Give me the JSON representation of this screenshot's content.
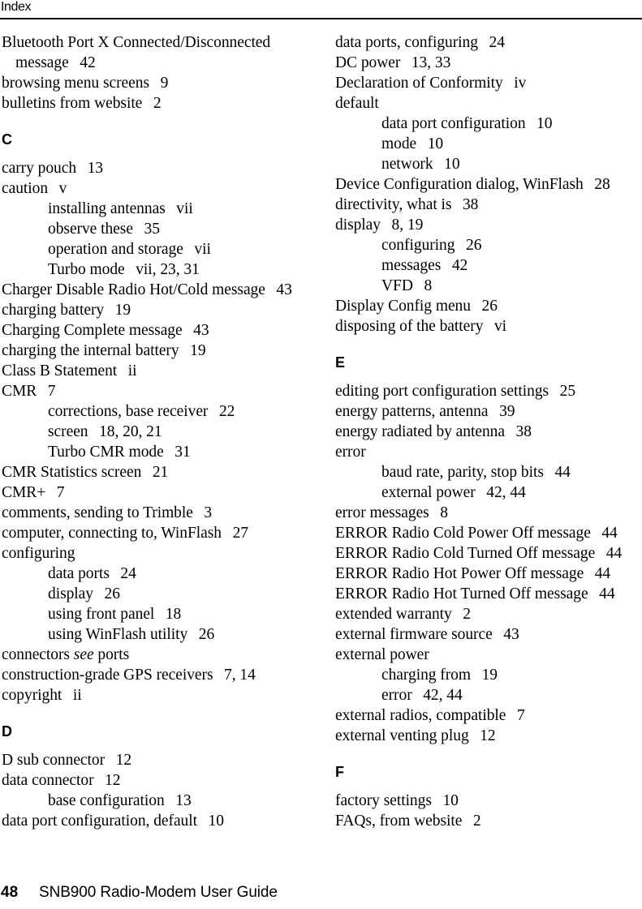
{
  "header": {
    "title": "Index"
  },
  "footer": {
    "page_number": "48",
    "document_title": "SNB900 Radio-Modem User Guide"
  },
  "columns": [
    {
      "id": "left",
      "groups": [
        {
          "letter": "",
          "show_letter": false,
          "entries": [
            {
              "level": "main",
              "text": "Bluetooth Port X Connected/Disconnected"
            },
            {
              "level": "cont",
              "text": "message",
              "locator": "42"
            },
            {
              "level": "main",
              "text": "browsing menu screens",
              "locator": "9"
            },
            {
              "level": "main",
              "text": "bulletins from website",
              "locator": "2"
            }
          ]
        },
        {
          "letter": "C",
          "show_letter": true,
          "entries": [
            {
              "level": "main",
              "text": "carry pouch",
              "locator": "13"
            },
            {
              "level": "main",
              "text": "caution",
              "locator": "v"
            },
            {
              "level": "sub",
              "text": "installing antennas",
              "locator": "vii"
            },
            {
              "level": "sub",
              "text": "observe these",
              "locator": "35"
            },
            {
              "level": "sub",
              "text": "operation and storage",
              "locator": "vii"
            },
            {
              "level": "sub",
              "text": "Turbo mode",
              "locator": "vii, 23, 31"
            },
            {
              "level": "main",
              "text": "Charger Disable Radio Hot/Cold message",
              "locator": "43"
            },
            {
              "level": "main",
              "text": "charging battery",
              "locator": "19"
            },
            {
              "level": "main",
              "text": "Charging Complete message",
              "locator": "43"
            },
            {
              "level": "main",
              "text": "charging the internal battery",
              "locator": "19"
            },
            {
              "level": "main",
              "text": "Class B Statement",
              "locator": "ii"
            },
            {
              "level": "main",
              "text": "CMR",
              "locator": "7"
            },
            {
              "level": "sub",
              "text": "corrections, base receiver",
              "locator": "22"
            },
            {
              "level": "sub",
              "text": "screen",
              "locator": "18, 20, 21"
            },
            {
              "level": "sub",
              "text": "Turbo CMR mode",
              "locator": "31"
            },
            {
              "level": "main",
              "text": "CMR Statistics screen",
              "locator": "21"
            },
            {
              "level": "main",
              "text": "CMR+",
              "locator": "7"
            },
            {
              "level": "main",
              "text": "comments, sending to Trimble",
              "locator": "3"
            },
            {
              "level": "main",
              "text": "computer, connecting to, WinFlash",
              "locator": "27"
            },
            {
              "level": "main",
              "text": "configuring"
            },
            {
              "level": "sub",
              "text": "data ports",
              "locator": "24"
            },
            {
              "level": "sub",
              "text": "display",
              "locator": "26"
            },
            {
              "level": "sub",
              "text": "using front panel",
              "locator": "18"
            },
            {
              "level": "sub",
              "text": "using WinFlash utility",
              "locator": "26"
            },
            {
              "level": "main",
              "text": "connectors ",
              "see": "see",
              "text_after": " ports"
            },
            {
              "level": "main",
              "text": "construction-grade GPS receivers",
              "locator": "7, 14"
            },
            {
              "level": "main",
              "text": "copyright",
              "locator": "ii"
            }
          ]
        },
        {
          "letter": "D",
          "show_letter": true,
          "entries": [
            {
              "level": "main",
              "text": "D sub connector",
              "locator": "12"
            },
            {
              "level": "main",
              "text": "data connector",
              "locator": "12"
            },
            {
              "level": "sub",
              "text": "base configuration",
              "locator": "13"
            },
            {
              "level": "main",
              "text": "data port configuration, default",
              "locator": "10"
            }
          ]
        }
      ]
    },
    {
      "id": "right",
      "groups": [
        {
          "letter": "",
          "show_letter": false,
          "entries": [
            {
              "level": "main",
              "text": "data ports, configuring",
              "locator": "24"
            },
            {
              "level": "main",
              "text": "DC power",
              "locator": "13, 33"
            },
            {
              "level": "main",
              "text": "Declaration of Conformity",
              "locator": "iv"
            },
            {
              "level": "main",
              "text": "default"
            },
            {
              "level": "sub",
              "text": "data port configuration",
              "locator": "10"
            },
            {
              "level": "sub",
              "text": "mode",
              "locator": "10"
            },
            {
              "level": "sub",
              "text": "network",
              "locator": "10"
            },
            {
              "level": "main",
              "text": "Device Configuration dialog, WinFlash",
              "locator": "28"
            },
            {
              "level": "main",
              "text": "directivity, what is",
              "locator": "38"
            },
            {
              "level": "main",
              "text": "display",
              "locator": "8, 19"
            },
            {
              "level": "sub",
              "text": "configuring",
              "locator": "26"
            },
            {
              "level": "sub",
              "text": "messages",
              "locator": "42"
            },
            {
              "level": "sub",
              "text": "VFD",
              "locator": "8"
            },
            {
              "level": "main",
              "text": "Display Config menu",
              "locator": "26"
            },
            {
              "level": "main",
              "text": "disposing of the battery",
              "locator": "vi"
            }
          ]
        },
        {
          "letter": "E",
          "show_letter": true,
          "entries": [
            {
              "level": "main",
              "text": "editing port configuration settings",
              "locator": "25"
            },
            {
              "level": "main",
              "text": "energy patterns, antenna",
              "locator": "39"
            },
            {
              "level": "main",
              "text": "energy radiated by antenna",
              "locator": "38"
            },
            {
              "level": "main",
              "text": "error"
            },
            {
              "level": "sub",
              "text": "baud rate, parity, stop bits",
              "locator": "44"
            },
            {
              "level": "sub",
              "text": "external power",
              "locator": "42, 44"
            },
            {
              "level": "main",
              "text": "error messages",
              "locator": "8"
            },
            {
              "level": "main",
              "text": "ERROR Radio Cold Power Off message",
              "locator": "44"
            },
            {
              "level": "main",
              "text": "ERROR Radio Cold Turned Off message",
              "locator": "44"
            },
            {
              "level": "main",
              "text": "ERROR Radio Hot Power Off message",
              "locator": "44"
            },
            {
              "level": "main",
              "text": "ERROR Radio Hot Turned Off message",
              "locator": "44"
            },
            {
              "level": "main",
              "text": "extended warranty",
              "locator": "2"
            },
            {
              "level": "main",
              "text": "external firmware source",
              "locator": "43"
            },
            {
              "level": "main",
              "text": "external power"
            },
            {
              "level": "sub",
              "text": "charging from",
              "locator": "19"
            },
            {
              "level": "sub",
              "text": "error",
              "locator": "42, 44"
            },
            {
              "level": "main",
              "text": "external radios, compatible",
              "locator": "7"
            },
            {
              "level": "main",
              "text": "external venting plug",
              "locator": "12"
            }
          ]
        },
        {
          "letter": "F",
          "show_letter": true,
          "entries": [
            {
              "level": "main",
              "text": "factory settings",
              "locator": "10"
            },
            {
              "level": "main",
              "text": "FAQs, from website",
              "locator": "2"
            }
          ]
        }
      ]
    }
  ]
}
